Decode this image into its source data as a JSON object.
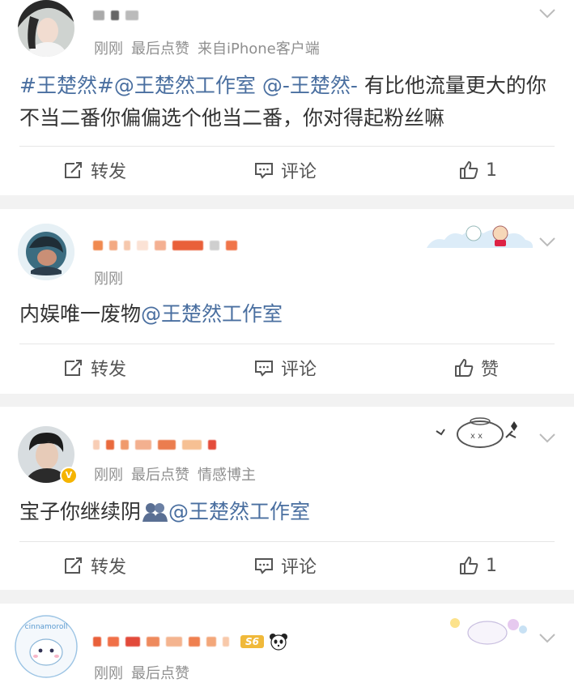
{
  "posts": [
    {
      "meta": [
        "刚刚",
        "最后点赞",
        "来自iPhone客户端"
      ],
      "content": [
        {
          "t": "#王楚然#",
          "link": true
        },
        {
          "t": "@王楚然工作室",
          "link": true
        },
        {
          "t": " ",
          "link": false
        },
        {
          "t": "@-王楚然-",
          "link": true
        },
        {
          "t": " 有比他流量更大的你不当二番你偏偏选个他当二番，你对得起粉丝嘛",
          "link": false
        }
      ],
      "actions": {
        "repost": "转发",
        "comment": "评论",
        "like": "1"
      }
    },
    {
      "meta": [
        "刚刚"
      ],
      "content": [
        {
          "t": "内娱唯一废物",
          "link": false
        },
        {
          "t": "@王楚然工作室",
          "link": true
        }
      ],
      "actions": {
        "repost": "转发",
        "comment": "评论",
        "like": "赞"
      }
    },
    {
      "meta": [
        "刚刚",
        "最后点赞",
        "情感博主"
      ],
      "content": [
        {
          "t": "宝子你继续阴",
          "link": false
        },
        {
          "t": "@王楚然工作室",
          "link": true
        }
      ],
      "actions": {
        "repost": "转发",
        "comment": "评论",
        "like": "1"
      }
    },
    {
      "meta": [
        "刚刚",
        "最后点赞"
      ],
      "badge": "S6",
      "avatar_text": "cinnamoroll"
    }
  ],
  "colors": {
    "link": "#4a6fa0",
    "meta": "#8f8f8f",
    "background": "#f2f2f2"
  }
}
